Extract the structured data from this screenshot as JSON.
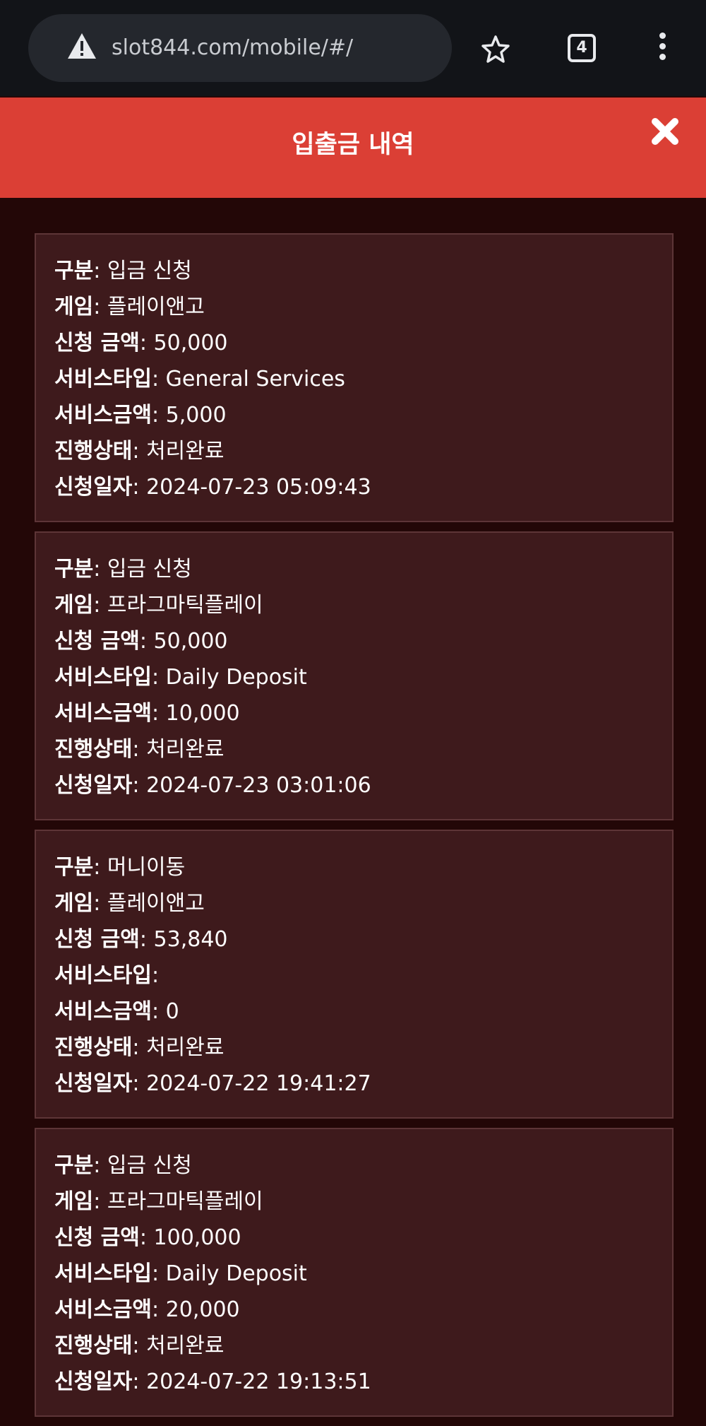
{
  "browser": {
    "url": "slot844.com/mobile/#/",
    "tab_count": "4"
  },
  "modal": {
    "title": "입출금 내역"
  },
  "labels": {
    "type": "구분",
    "game": "게임",
    "amount": "신청 금액",
    "service_type": "서비스타입",
    "service_amount": "서비스금액",
    "status": "진행상태",
    "date": "신청일자"
  },
  "records": [
    {
      "type": "입금 신청",
      "game": "플레이앤고",
      "amount": "50,000",
      "service_type": "General Services",
      "service_amount": "5,000",
      "status": "처리완료",
      "date": "2024-07-23 05:09:43"
    },
    {
      "type": "입금 신청",
      "game": "프라그마틱플레이",
      "amount": "50,000",
      "service_type": "Daily Deposit",
      "service_amount": "10,000",
      "status": "처리완료",
      "date": "2024-07-23 03:01:06"
    },
    {
      "type": "머니이동",
      "game": "플레이앤고",
      "amount": "53,840",
      "service_type": "",
      "service_amount": "0",
      "status": "처리완료",
      "date": "2024-07-22 19:41:27"
    },
    {
      "type": "입금 신청",
      "game": "프라그마틱플레이",
      "amount": "100,000",
      "service_type": "Daily Deposit",
      "service_amount": "20,000",
      "status": "처리완료",
      "date": "2024-07-22 19:13:51"
    }
  ]
}
